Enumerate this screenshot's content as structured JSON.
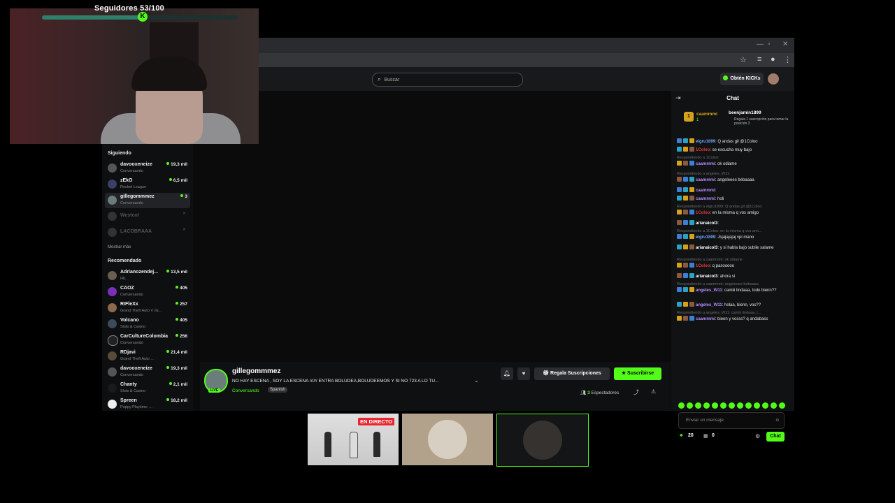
{
  "overlay": {
    "follow_goal": "Seguidores 53/100",
    "progress": 0.53,
    "k_label": "K"
  },
  "browser": {
    "search_placeholder": "Buscar",
    "kicks_label": "Obtén KICKs"
  },
  "sidebar": {
    "following_title": "Siguiendo",
    "following": [
      {
        "name": "davooxeneize",
        "category": "Conversando",
        "viewers": "19,3 mil"
      },
      {
        "name": "zEkO",
        "category": "Rocket League",
        "viewers": "6,5 mil"
      },
      {
        "name": "gillegommmez",
        "category": "Conversando",
        "viewers": "3",
        "active": true
      },
      {
        "name": "Westcol",
        "offline": true
      },
      {
        "name": "LACOBRAAA",
        "offline": true
      }
    ],
    "show_more": "Mostrar más",
    "recommended_title": "Recomendado",
    "recommended": [
      {
        "name": "Adrianozendej...",
        "category": "IRL",
        "viewers": "13,5 mil"
      },
      {
        "name": "CAOZ",
        "category": "Conversando",
        "viewers": "405"
      },
      {
        "name": "RIFleXx",
        "category": "Grand Theft Auto V (G...",
        "viewers": "257"
      },
      {
        "name": "Volcano",
        "category": "Slots & Casino",
        "viewers": "405"
      },
      {
        "name": "CarCultureColombia",
        "category": "Conversando",
        "viewers": "256"
      },
      {
        "name": "RDjavi",
        "category": "Grand Theft Auto ...",
        "viewers": "21,4 mil"
      },
      {
        "name": "davooxeneize",
        "category": "Conversando",
        "viewers": "19,3 mil"
      },
      {
        "name": "Chanty",
        "category": "Slots & Casino",
        "viewers": "2,1 mil"
      },
      {
        "name": "Spreen",
        "category": "Poppy Playtime: ...",
        "viewers": "18,2 mil"
      }
    ]
  },
  "stream": {
    "streamer": "gillegommmez",
    "live_tag": "LIVE",
    "title": "NO HAY ESCENA , SOY LA ESCENA ////// ENTRA BOLUDEA,BOLUDEEMOS Y SI NO 723 A LO TU...",
    "category": "Conversando",
    "language": "Spanish",
    "gift_label": "Regala Suscripciones",
    "subscribe_label": "Suscribirse",
    "viewer_count": "3",
    "viewer_suffix": "Espectadores"
  },
  "chat": {
    "title": "Chat",
    "pinned": {
      "user1": "caammmi",
      "user1_months": "1",
      "user2": "beenjamin1899",
      "user2_count": "1",
      "user2_note": "Regala 1 suscripción para tomar la posición 3"
    },
    "messages": [
      {
        "user": "eigru1899",
        "color": "u-blue",
        "text": ": Q andas gil @1Coloo"
      },
      {
        "user": "1Coloo",
        "color": "u-red",
        "text": ": se escucha muy bajo"
      },
      {
        "reply": "Respondiendo a 1Coloo:",
        "user": "caammmi",
        "color": "u-purple",
        "text": ": ok odiame"
      },
      {
        "reply": "Respondiendo a angeles_W11:",
        "user": "caammmi",
        "color": "u-purple",
        "text": ": angeleees bebaaaa"
      },
      {
        "user": "caammmi",
        "color": "u-purple",
        "text": ":"
      },
      {
        "user": "caammmi",
        "color": "u-purple",
        "text": ": holi"
      },
      {
        "reply": "Respondiendo a eigru1899: Q andas gil @1Coloo",
        "user": "1Coloo",
        "color": "u-red",
        "text": ": en la misma q vos amigo"
      },
      {
        "user": "arianaicol3",
        "color": "u-white",
        "text": ":"
      },
      {
        "reply": "Respondiendo a 1Coloo: en la misma q vos ami...",
        "user": "eigru1899",
        "color": "u-blue",
        "text": ": Jsjajajajaj vpi mano"
      },
      {
        "user": "arianaicol3",
        "color": "u-white",
        "text": ": y si habla bajo subile salame"
      },
      {
        "reply": "Respondiendo a caammmi: ok odiame",
        "user": "1Coloo",
        "color": "u-red",
        "text": ": q pasooooo"
      },
      {
        "user": "arianaicol3",
        "color": "u-white",
        "text": ": ahora si"
      },
      {
        "reply": "Respondiendo a caammmi: angeleees bebaaaa",
        "user": "angeles_W11",
        "color": "u-purple",
        "text": ": camiii lindaaa, todo bienn??"
      },
      {
        "user": "angeles_W11",
        "color": "u-purple",
        "text": ": holaa, bienn, vos??"
      },
      {
        "reply": "Respondiendo a angeles_W11: camiii lindaaa, t...",
        "user": "caammmi",
        "color": "u-purple",
        "text": ": bieen y vosss? q andabass"
      }
    ],
    "input_placeholder": "Enviar un mensaje",
    "points": "20",
    "gifts": "0",
    "send_label": "Chat"
  },
  "thumbnails": {
    "live_label": "EN DIRECTO"
  },
  "colors": {
    "accent": "#53fc18",
    "live_red": "#e9262d"
  }
}
